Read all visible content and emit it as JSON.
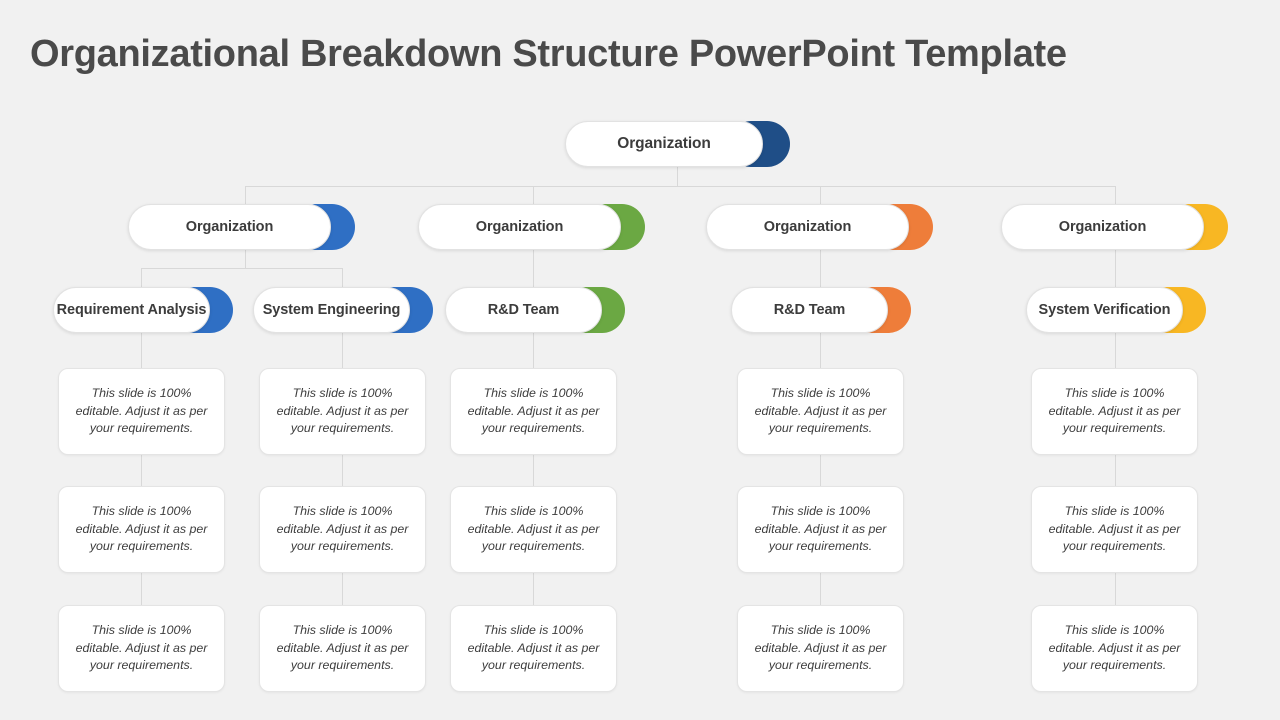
{
  "page": {
    "title": "Organizational Breakdown Structure PowerPoint Template",
    "background_color": "#f1f1f1",
    "title_color": "#4a4a4a",
    "connector_color": "#d8d8d8"
  },
  "palette": {
    "navy": "#1f4e87",
    "blue": "#2f6fc4",
    "green": "#6ba843",
    "orange": "#ee7d3a",
    "yellow": "#f8b723"
  },
  "note_text": "This slide is 100% editable. Adjust it as per your requirements.",
  "root": {
    "label": "Organization",
    "accent": "#1f4e87"
  },
  "level2": [
    {
      "label": "Organization",
      "accent": "#2f6fc4"
    },
    {
      "label": "Organization",
      "accent": "#6ba843"
    },
    {
      "label": "Organization",
      "accent": "#ee7d3a"
    },
    {
      "label": "Organization",
      "accent": "#f8b723"
    }
  ],
  "level3": [
    {
      "label": "Requirement Analysis",
      "accent": "#2f6fc4"
    },
    {
      "label": "System Engineering",
      "accent": "#2f6fc4"
    },
    {
      "label": "R&D Team",
      "accent": "#6ba843"
    },
    {
      "label": "R&D Team",
      "accent": "#ee7d3a"
    },
    {
      "label": "System Verification",
      "accent": "#f8b723"
    }
  ],
  "columns": [
    {
      "notes": [
        "This slide is 100% editable. Adjust it as per your requirements.",
        "This slide is 100% editable. Adjust it as per your requirements.",
        "This slide is 100% editable. Adjust it as per your requirements."
      ]
    },
    {
      "notes": [
        "This slide is 100% editable. Adjust it as per your requirements.",
        "This slide is 100% editable. Adjust it as per your requirements.",
        "This slide is 100% editable. Adjust it as per your requirements."
      ]
    },
    {
      "notes": [
        "This slide is 100% editable. Adjust it as per your requirements.",
        "This slide is 100% editable. Adjust it as per your requirements.",
        "This slide is 100% editable. Adjust it as per your requirements."
      ]
    },
    {
      "notes": [
        "This slide is 100% editable. Adjust it as per your requirements.",
        "This slide is 100% editable. Adjust it as per your requirements.",
        "This slide is 100% editable. Adjust it as per your requirements."
      ]
    },
    {
      "notes": [
        "This slide is 100% editable. Adjust it as per your requirements.",
        "This slide is 100% editable. Adjust it as per your requirements.",
        "This slide is 100% editable. Adjust it as per your requirements."
      ]
    }
  ]
}
